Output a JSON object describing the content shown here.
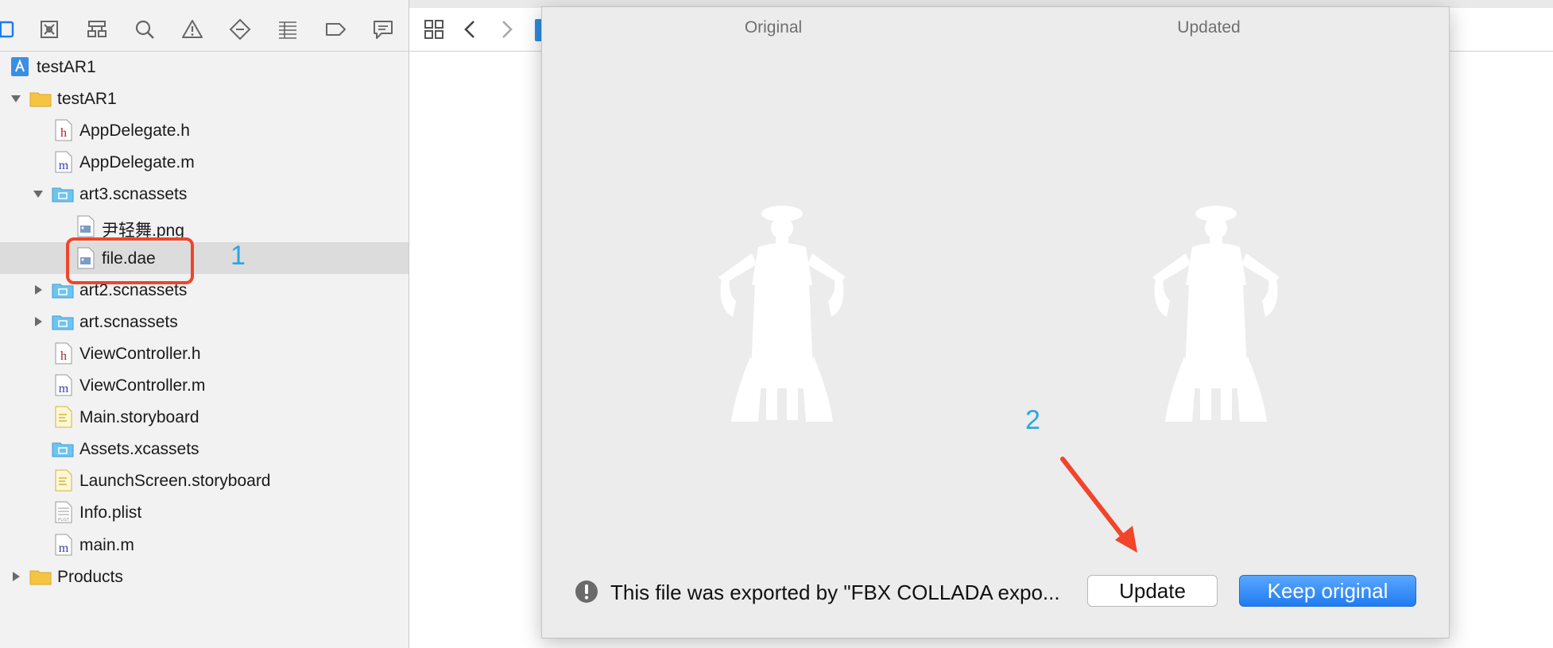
{
  "colors": {
    "accent_blue": "#1f7cf0",
    "annotation_red": "#f0452b",
    "annotation_blue": "#2aa6e6",
    "folder_yellow": "#f5c542",
    "asset_folder_blue": "#6ec3ef"
  },
  "navigator": {
    "toolbar_icons": [
      "project-navigator-icon",
      "source-control-icon",
      "symbol-navigator-icon",
      "find-icon",
      "issue-icon",
      "test-icon",
      "debug-icon",
      "breakpoint-icon",
      "report-icon"
    ],
    "tree": [
      {
        "label": "testAR1",
        "kind": "project",
        "level": 0,
        "disclosure": "none"
      },
      {
        "label": "testAR1",
        "kind": "folder",
        "level": 0,
        "disclosure": "expanded"
      },
      {
        "label": "AppDelegate.h",
        "kind": "header",
        "level": 1,
        "disclosure": "none"
      },
      {
        "label": "AppDelegate.m",
        "kind": "source",
        "level": 1,
        "disclosure": "none"
      },
      {
        "label": "art3.scnassets",
        "kind": "asset-folder",
        "level": 1,
        "disclosure": "expanded"
      },
      {
        "label": "尹轻舞.png",
        "kind": "image",
        "level": 2,
        "disclosure": "none"
      },
      {
        "label": "file.dae",
        "kind": "image",
        "level": 2,
        "disclosure": "none",
        "selected": true
      },
      {
        "label": "art2.scnassets",
        "kind": "asset-folder",
        "level": 1,
        "disclosure": "collapsed"
      },
      {
        "label": "art.scnassets",
        "kind": "asset-folder",
        "level": 1,
        "disclosure": "collapsed"
      },
      {
        "label": "ViewController.h",
        "kind": "header",
        "level": 1,
        "disclosure": "none"
      },
      {
        "label": "ViewController.m",
        "kind": "source",
        "level": 1,
        "disclosure": "none"
      },
      {
        "label": "Main.storyboard",
        "kind": "storyboard",
        "level": 1,
        "disclosure": "none"
      },
      {
        "label": "Assets.xcassets",
        "kind": "asset-folder",
        "level": 1,
        "disclosure": "none"
      },
      {
        "label": "LaunchScreen.storyboard",
        "kind": "storyboard",
        "level": 1,
        "disclosure": "none"
      },
      {
        "label": "Info.plist",
        "kind": "plist",
        "level": 1,
        "disclosure": "none"
      },
      {
        "label": "main.m",
        "kind": "source",
        "level": 1,
        "disclosure": "none"
      },
      {
        "label": "Products",
        "kind": "folder",
        "level": 0,
        "disclosure": "collapsed"
      }
    ]
  },
  "editor_toolbar": {
    "icons": [
      "related-items-icon",
      "back-arrow-icon",
      "forward-arrow-icon"
    ]
  },
  "dialog": {
    "original_title": "Original",
    "updated_title": "Updated",
    "warning_text": "This file was exported by \"FBX COLLADA expo...",
    "update_label": "Update",
    "keep_original_label": "Keep original"
  },
  "annotations": {
    "step1": "1",
    "step2": "2"
  }
}
